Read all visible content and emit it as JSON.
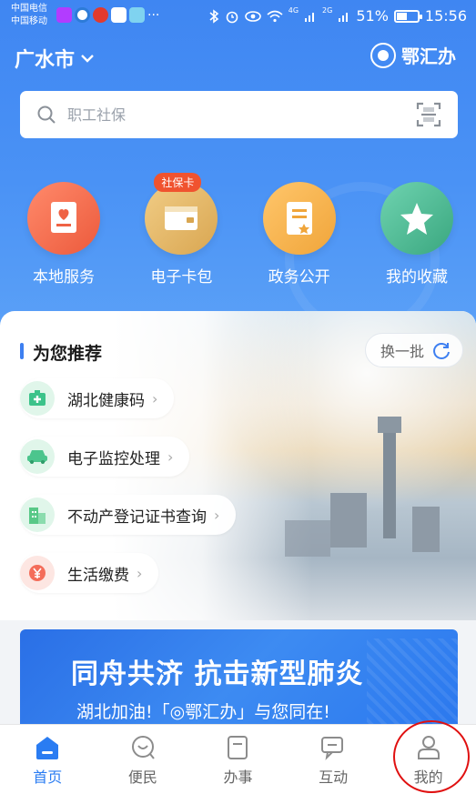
{
  "status_bar": {
    "carrier_1": "中国电信",
    "carrier_2": "中国移动",
    "network_1": "4G",
    "network_2": "2G",
    "battery": "51%",
    "battery_level": 0.51,
    "time": "15:56"
  },
  "header": {
    "city": "广水市",
    "brand_name": "鄂汇办"
  },
  "search": {
    "placeholder": "职工社保"
  },
  "quick_services": [
    {
      "label": "本地服务",
      "icon": "local-service-icon",
      "color": "#f26a4e"
    },
    {
      "label": "电子卡包",
      "icon": "wallet-icon",
      "color": "#e8b96c",
      "badge": "社保卡"
    },
    {
      "label": "政务公开",
      "icon": "document-icon",
      "color": "#f2b04a"
    },
    {
      "label": "我的收藏",
      "icon": "star-icon",
      "color": "#4bb894"
    }
  ],
  "recommend": {
    "title": "为您推荐",
    "refresh_label": "换一批",
    "items": [
      {
        "label": "湖北健康码",
        "icon": "health-code-icon",
        "color": "#3cc38a"
      },
      {
        "label": "电子监控处理",
        "icon": "car-icon",
        "color": "#4cc58d"
      },
      {
        "label": "不动产登记证书查询",
        "icon": "building-icon",
        "color": "#58c887"
      },
      {
        "label": "生活缴费",
        "icon": "payment-icon",
        "color": "#f46d5a"
      }
    ]
  },
  "banner": {
    "title": "同舟共济 抗击新型肺炎",
    "subtitle": "湖北加油!「◎鄂汇办」与您同在!"
  },
  "tabs": [
    {
      "label": "首页",
      "icon": "home-icon",
      "active": true
    },
    {
      "label": "便民",
      "icon": "convenience-icon",
      "active": false
    },
    {
      "label": "办事",
      "icon": "affairs-icon",
      "active": false
    },
    {
      "label": "互动",
      "icon": "chat-icon",
      "active": false
    },
    {
      "label": "我的",
      "icon": "profile-icon",
      "active": false
    }
  ],
  "colors": {
    "primary": "#3f86f2",
    "tab_active": "#2a7cf2",
    "highlight_ring": "#e01010"
  }
}
